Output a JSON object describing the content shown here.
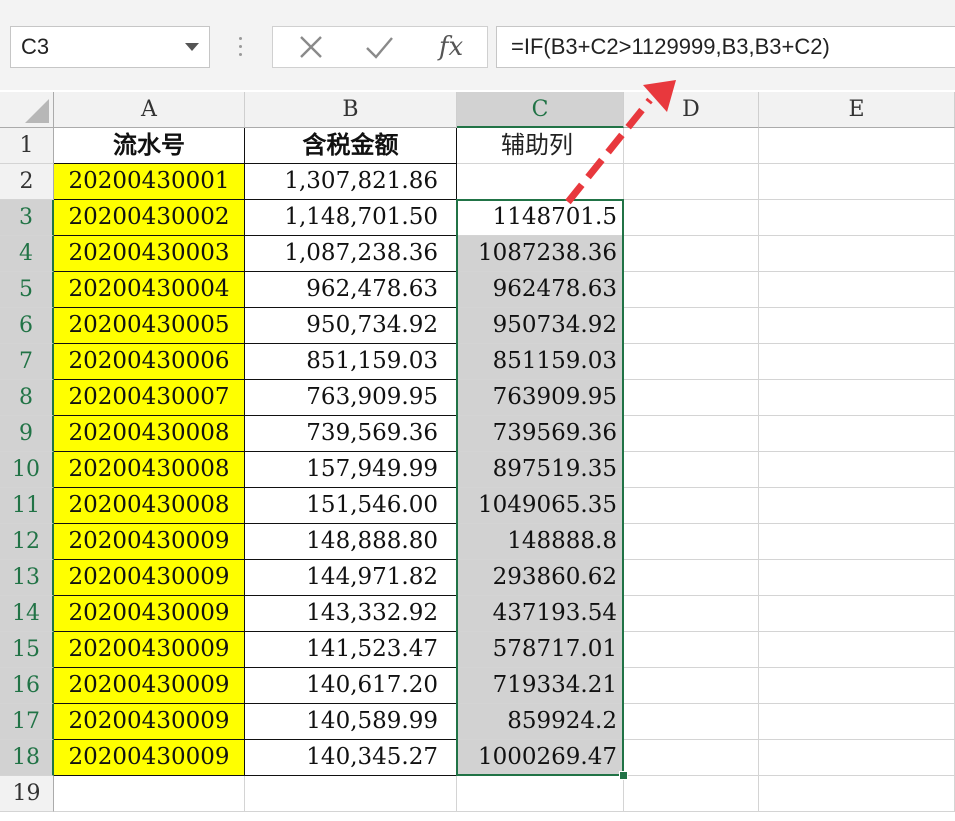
{
  "formula_bar": {
    "name_box": "C3",
    "fx_label": "fx",
    "formula": "=IF(B3+C2>1129999,B3,B3+C2)"
  },
  "columns": [
    "A",
    "B",
    "C",
    "D",
    "E"
  ],
  "row_numbers": [
    "1",
    "2",
    "3",
    "4",
    "5",
    "6",
    "7",
    "8",
    "9",
    "10",
    "11",
    "12",
    "13",
    "14",
    "15",
    "16",
    "17",
    "18",
    "19"
  ],
  "headers": {
    "a": "流水号",
    "b": "含税金额",
    "c": "辅助列"
  },
  "rows": [
    {
      "a": "20200430001",
      "b": "1,307,821.86",
      "c": ""
    },
    {
      "a": "20200430002",
      "b": "1,148,701.50",
      "c": "1148701.5"
    },
    {
      "a": "20200430003",
      "b": "1,087,238.36",
      "c": "1087238.36"
    },
    {
      "a": "20200430004",
      "b": "962,478.63",
      "c": "962478.63"
    },
    {
      "a": "20200430005",
      "b": "950,734.92",
      "c": "950734.92"
    },
    {
      "a": "20200430006",
      "b": "851,159.03",
      "c": "851159.03"
    },
    {
      "a": "20200430007",
      "b": "763,909.95",
      "c": "763909.95"
    },
    {
      "a": "20200430008",
      "b": "739,569.36",
      "c": "739569.36"
    },
    {
      "a": "20200430008",
      "b": "157,949.99",
      "c": "897519.35"
    },
    {
      "a": "20200430008",
      "b": "151,546.00",
      "c": "1049065.35"
    },
    {
      "a": "20200430009",
      "b": "148,888.80",
      "c": "148888.8"
    },
    {
      "a": "20200430009",
      "b": "144,971.82",
      "c": "293860.62"
    },
    {
      "a": "20200430009",
      "b": "143,332.92",
      "c": "437193.54"
    },
    {
      "a": "20200430009",
      "b": "141,523.47",
      "c": "578717.01"
    },
    {
      "a": "20200430009",
      "b": "140,617.20",
      "c": "719334.21"
    },
    {
      "a": "20200430009",
      "b": "140,589.99",
      "c": "859924.2"
    },
    {
      "a": "20200430009",
      "b": "140,345.27",
      "c": "1000269.47"
    }
  ],
  "colors": {
    "accent": "#217346",
    "highlight": "#ffff00",
    "arrow": "#e8383d"
  }
}
